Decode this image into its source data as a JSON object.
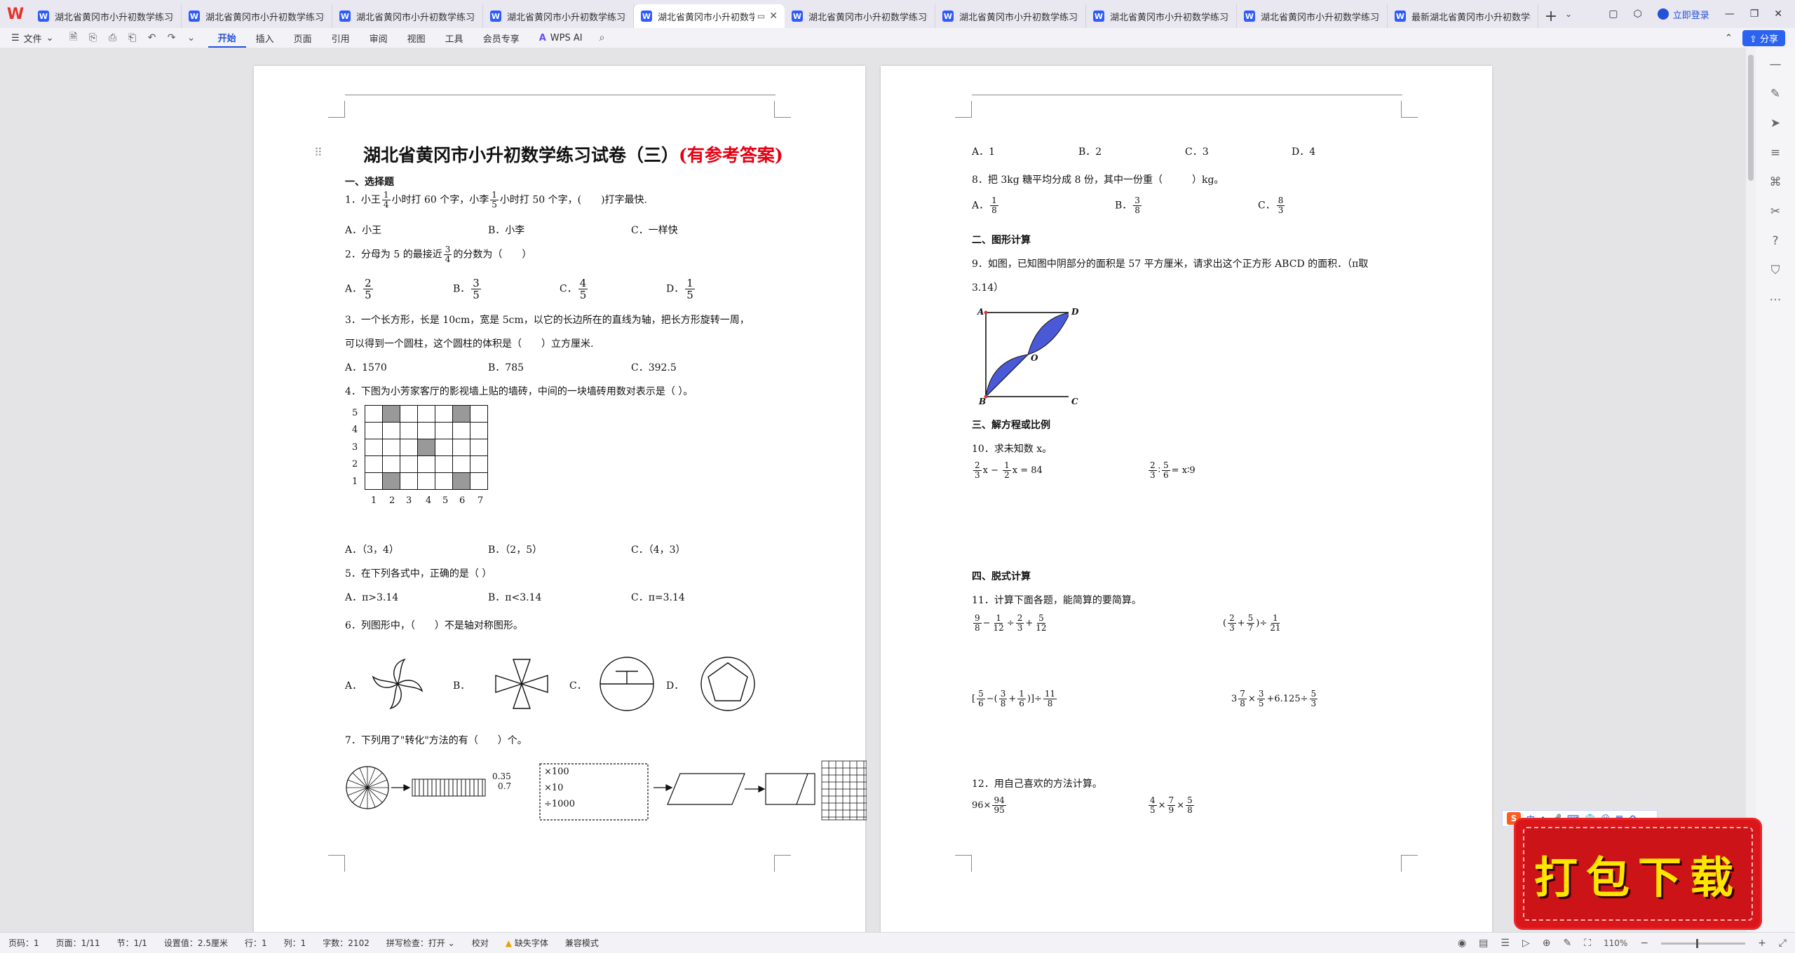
{
  "tabs": [
    {
      "title": "湖北省黄冈市小升初数学练习试",
      "active": false
    },
    {
      "title": "湖北省黄冈市小升初数学练习试",
      "active": false
    },
    {
      "title": "湖北省黄冈市小升初数学练习试",
      "active": false
    },
    {
      "title": "湖北省黄冈市小升初数学练习试",
      "active": false
    },
    {
      "title": "湖北省黄冈市小升初数学",
      "active": true
    },
    {
      "title": "湖北省黄冈市小升初数学练习试",
      "active": false
    },
    {
      "title": "湖北省黄冈市小升初数学练习试",
      "active": false
    },
    {
      "title": "湖北省黄冈市小升初数学练习试",
      "active": false
    },
    {
      "title": "湖北省黄冈市小升初数学练习试",
      "active": false
    },
    {
      "title": "最新湖北省黄冈市小升初数学练",
      "active": false
    }
  ],
  "titlebar": {
    "login": "立即登录"
  },
  "ribbon": {
    "file_menu": "文件",
    "tabs": [
      "开始",
      "插入",
      "页面",
      "引用",
      "审阅",
      "视图",
      "工具",
      "会员专享"
    ],
    "active_tab": "开始",
    "ai": "WPS AI",
    "share": "分享"
  },
  "doc": {
    "title_main": "湖北省黄冈市小升初数学练习试卷（三）",
    "title_ans": "(有参考答案)",
    "sec1": "一、选择题",
    "q1a": "1．小王",
    "q1b": "小时打 60 个字，小李",
    "q1c": "小时打 50 个字，(　　)打字最快.",
    "q1_opts": [
      "A．小王",
      "B．小李",
      "C．一样快"
    ],
    "q2a": "2．分母为 5 的最接近",
    "q2b": "的分数为（　　）",
    "q2_labels": [
      "A．",
      "B．",
      "C．",
      "D．"
    ],
    "q3_line1": "3．一个长方形，长是 10cm，宽是 5cm，以它的长边所在的直线为轴，把长方形旋转一周，",
    "q3_line2": "可以得到一个圆柱，这个圆柱的体积是（　　）立方厘米.",
    "q3_opts": [
      "A．1570",
      "B．785",
      "C．392.5"
    ],
    "q4": "4．下图为小芳家客厅的影视墙上贴的墙砖，中间的一块墙砖用数对表示是（  ）。",
    "q4_ylabels": [
      "5",
      "4",
      "3",
      "2",
      "1"
    ],
    "q4_xlabels": [
      "1",
      "2",
      "3",
      "4",
      "5",
      "6",
      "7"
    ],
    "q4_opts": [
      "A．（3，4）",
      "B．（2，5）",
      "C．（4，3）"
    ],
    "q5": "5．在下列各式中，正确的是（  ）",
    "q5_opts": [
      "A．π>3.14",
      "B．π<3.14",
      "C．π=3.14"
    ],
    "q6": "6．列图形中，（　　）不是轴对称图形。",
    "q6_labels": [
      "A．",
      "B．",
      "C．",
      "D．"
    ],
    "q7": "7．下列用了\"转化\"方法的有（　　）个。",
    "q7_dec": [
      "0.35",
      "0.7"
    ],
    "q7_ops": [
      "×100",
      "×10",
      "÷1000"
    ],
    "r_opts_top": [
      "A．1",
      "B．2",
      "C．3",
      "D．4"
    ],
    "q8": "8．把 3kg 糖平均分成 8 份，其中一份重（　　　）kg。",
    "q8_labels": [
      "A．",
      "B．",
      "C．"
    ],
    "sec2": "二、图形计算",
    "q9_line1": "9．如图，已知图中阴部分的面积是 57 平方厘米，请求出这个正方形 ABCD 的面积．（π取",
    "q9_line2": "3.14）",
    "q9_points": [
      "A",
      "D",
      "O",
      "B",
      "C"
    ],
    "sec3": "三、解方程或比例",
    "q10": "10．求未知数 x。",
    "q10_eq1_tail": "x = 84",
    "q10_eq2_tail": "= x∶9",
    "sec4": "四、脱式计算",
    "q11": "11．计算下面各题，能简算的要简算。",
    "q11_e3_tail": "6.125",
    "q12": "12．用自己喜欢的方法计算。",
    "q12_e1_head": "96×"
  },
  "status": {
    "page_num": "页码：1",
    "pages": "页面：1/11",
    "section": "节：1/1",
    "setting": "设置值：2.5厘米",
    "row": "行：1",
    "col": "列：1",
    "words": "字数：2102",
    "spell": "拼写检查：打开",
    "proof": "校对",
    "missing_font": "缺失字体",
    "compat": "兼容模式",
    "zoom": "110%"
  },
  "ime": {
    "mode": "中"
  },
  "banner": {
    "text": "打包下载"
  }
}
